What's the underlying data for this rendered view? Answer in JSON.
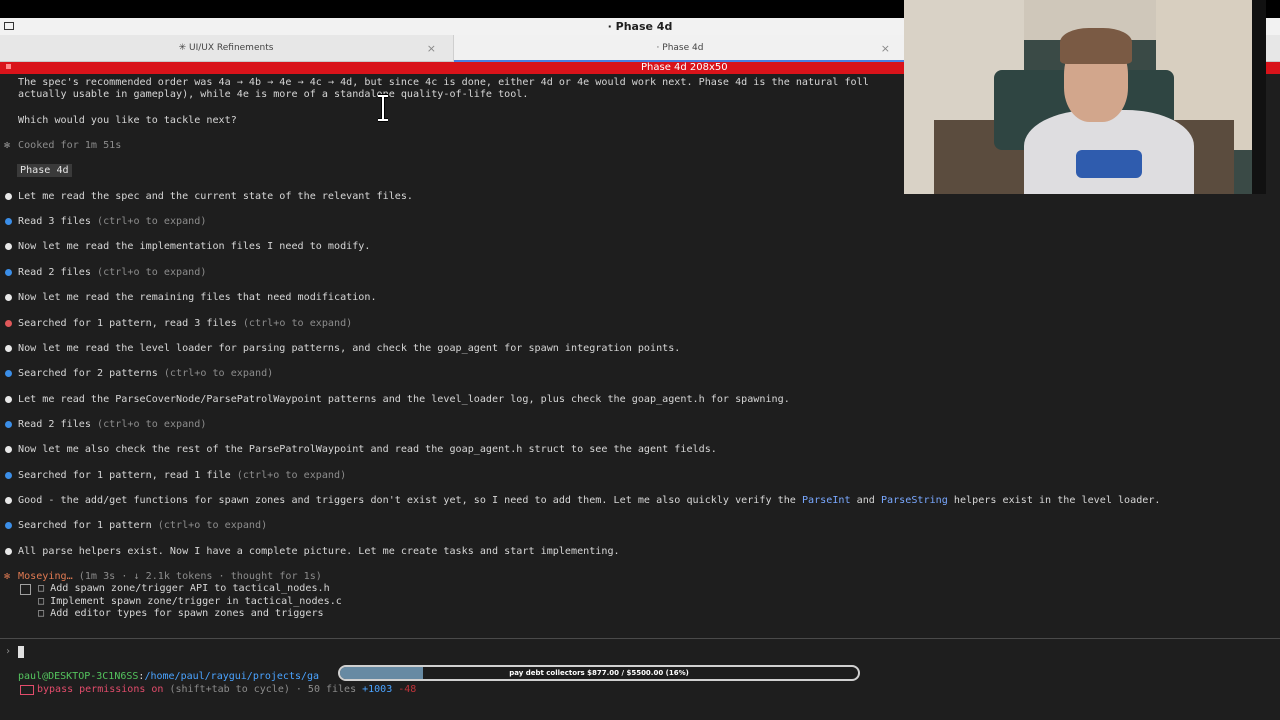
{
  "window": {
    "title": "· Phase 4d"
  },
  "tabs": [
    {
      "label": "✳ UI/UX Refinements",
      "close": "×"
    },
    {
      "label": "· Phase 4d",
      "close": "×"
    }
  ],
  "pane_header": {
    "label": "Phase 4d 208x50"
  },
  "lines": {
    "spec1": "The spec's recommended order was 4a → 4b → 4e → 4c → 4d, but since 4c is done, either 4d or 4e would work next. Phase 4d is the natural foll",
    "spec2": "actually usable in gameplay), while 4e is more of a standalone quality-of-life tool.",
    "question": "Which would you like to tackle next?",
    "cooked": "Cooked for 1m 51s",
    "phase_prompt": "Phase 4d",
    "l1": "Let me read the spec and the current state of the relevant files.",
    "l2_main": "Read 3 files",
    "l2_hint": " (ctrl+o to expand)",
    "l3": "Now let me read the implementation files I need to modify.",
    "l4_main": "Read 2 files",
    "l4_hint": " (ctrl+o to expand)",
    "l5": "Now let me read the remaining files that need modification.",
    "l6_main": "Searched for 1 pattern, read 3 files",
    "l6_hint": " (ctrl+o to expand)",
    "l7": "Now let me read the level loader for parsing patterns, and check the goap_agent for spawn integration points.",
    "l8_main": "Searched for 2 patterns",
    "l8_hint": " (ctrl+o to expand)",
    "l9": "Let me read the ParseCoverNode/ParsePatrolWaypoint patterns and the level_loader log, plus check the goap_agent.h for spawning.",
    "l10_main": "Read 2 files",
    "l10_hint": " (ctrl+o to expand)",
    "l11": "Now let me also check the rest of the ParsePatrolWaypoint and read the goap_agent.h struct to see the agent fields.",
    "l12_main": "Searched for 1 pattern, read 1 file",
    "l12_hint": " (ctrl+o to expand)",
    "l13_a": "Good - the add/get functions for spawn zones and triggers don't exist yet, so I need to add them. Let me also quickly verify the ",
    "l13_kw1": "ParseInt",
    "l13_b": " and ",
    "l13_kw2": "ParseString",
    "l13_c": " helpers exist in the level loader.",
    "l14_main": "Searched for 1 pattern",
    "l14_hint": " (ctrl+o to expand)",
    "l15": "All parse helpers exist. Now I have a complete picture. Let me create tasks and start implementing.",
    "moseying": "Moseying…",
    "moseying_meta": " (1m 3s · ↓ 2.1k tokens · thought for 1s)"
  },
  "tasks": [
    "Add spawn zone/trigger API to tactical_nodes.h",
    "Implement spawn zone/trigger in tactical_nodes.c",
    "Add editor types for spawn zones and triggers"
  ],
  "task_box": "□",
  "status": {
    "user": "paul@DESKTOP-3C1N6SS",
    "sep": ":",
    "path": "/home/paul/raygui/projects/ga",
    "perm": "bypass permissions on",
    "perm_rest": " (shift+tab to cycle) · 50 files ",
    "added": "+1003",
    "removed": " -48"
  },
  "progress": {
    "label": "pay debt collectors $877.00 / $5500.00 (16%)",
    "value": 0.16
  },
  "prompt_caret": "›"
}
